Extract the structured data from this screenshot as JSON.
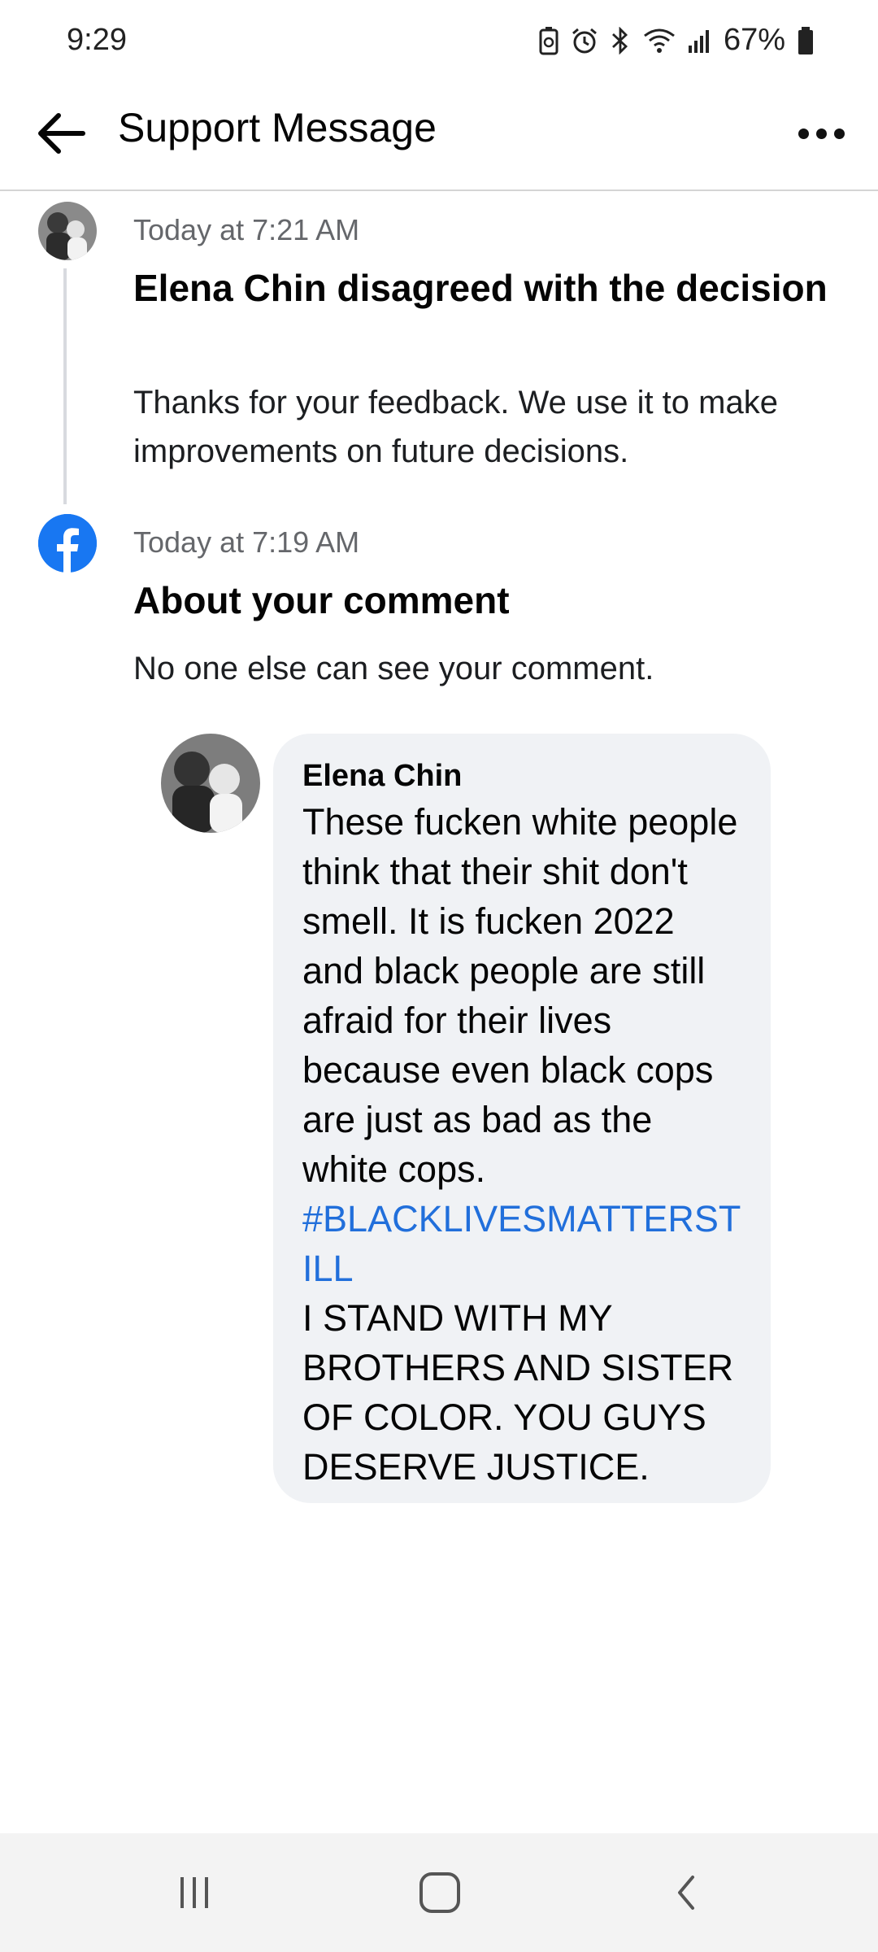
{
  "status_bar": {
    "time": "9:29",
    "battery": "67%"
  },
  "app_bar": {
    "title": "Support Message"
  },
  "timeline": [
    {
      "time": "Today at 7:21 AM",
      "title": "Elena Chin disagreed with the decision",
      "body": "Thanks for your feedback. We use it to make improvements on future decisions."
    },
    {
      "time": "Today at 7:19 AM",
      "title": "About your comment",
      "body": "No one else can see your comment."
    }
  ],
  "comment": {
    "author": "Elena Chin",
    "text": "These fucken white people think that their shit don't smell. It is fucken 2022 and black people are still afraid for their lives because even black cops are just as bad as the white cops.",
    "hashtag": "#BLACKLIVESMATTERSTILL",
    "text2": "I STAND WITH MY BROTHERS AND SISTER OF COLOR. YOU GUYS DESERVE JUSTICE."
  },
  "colors": {
    "accent": "#1877f2",
    "link": "#216fdb",
    "bubble": "#f0f2f5"
  },
  "icons": [
    "arrow-back-icon",
    "more-icon",
    "facebook-icon",
    "recent-apps-icon",
    "home-icon",
    "back-nav-icon"
  ]
}
